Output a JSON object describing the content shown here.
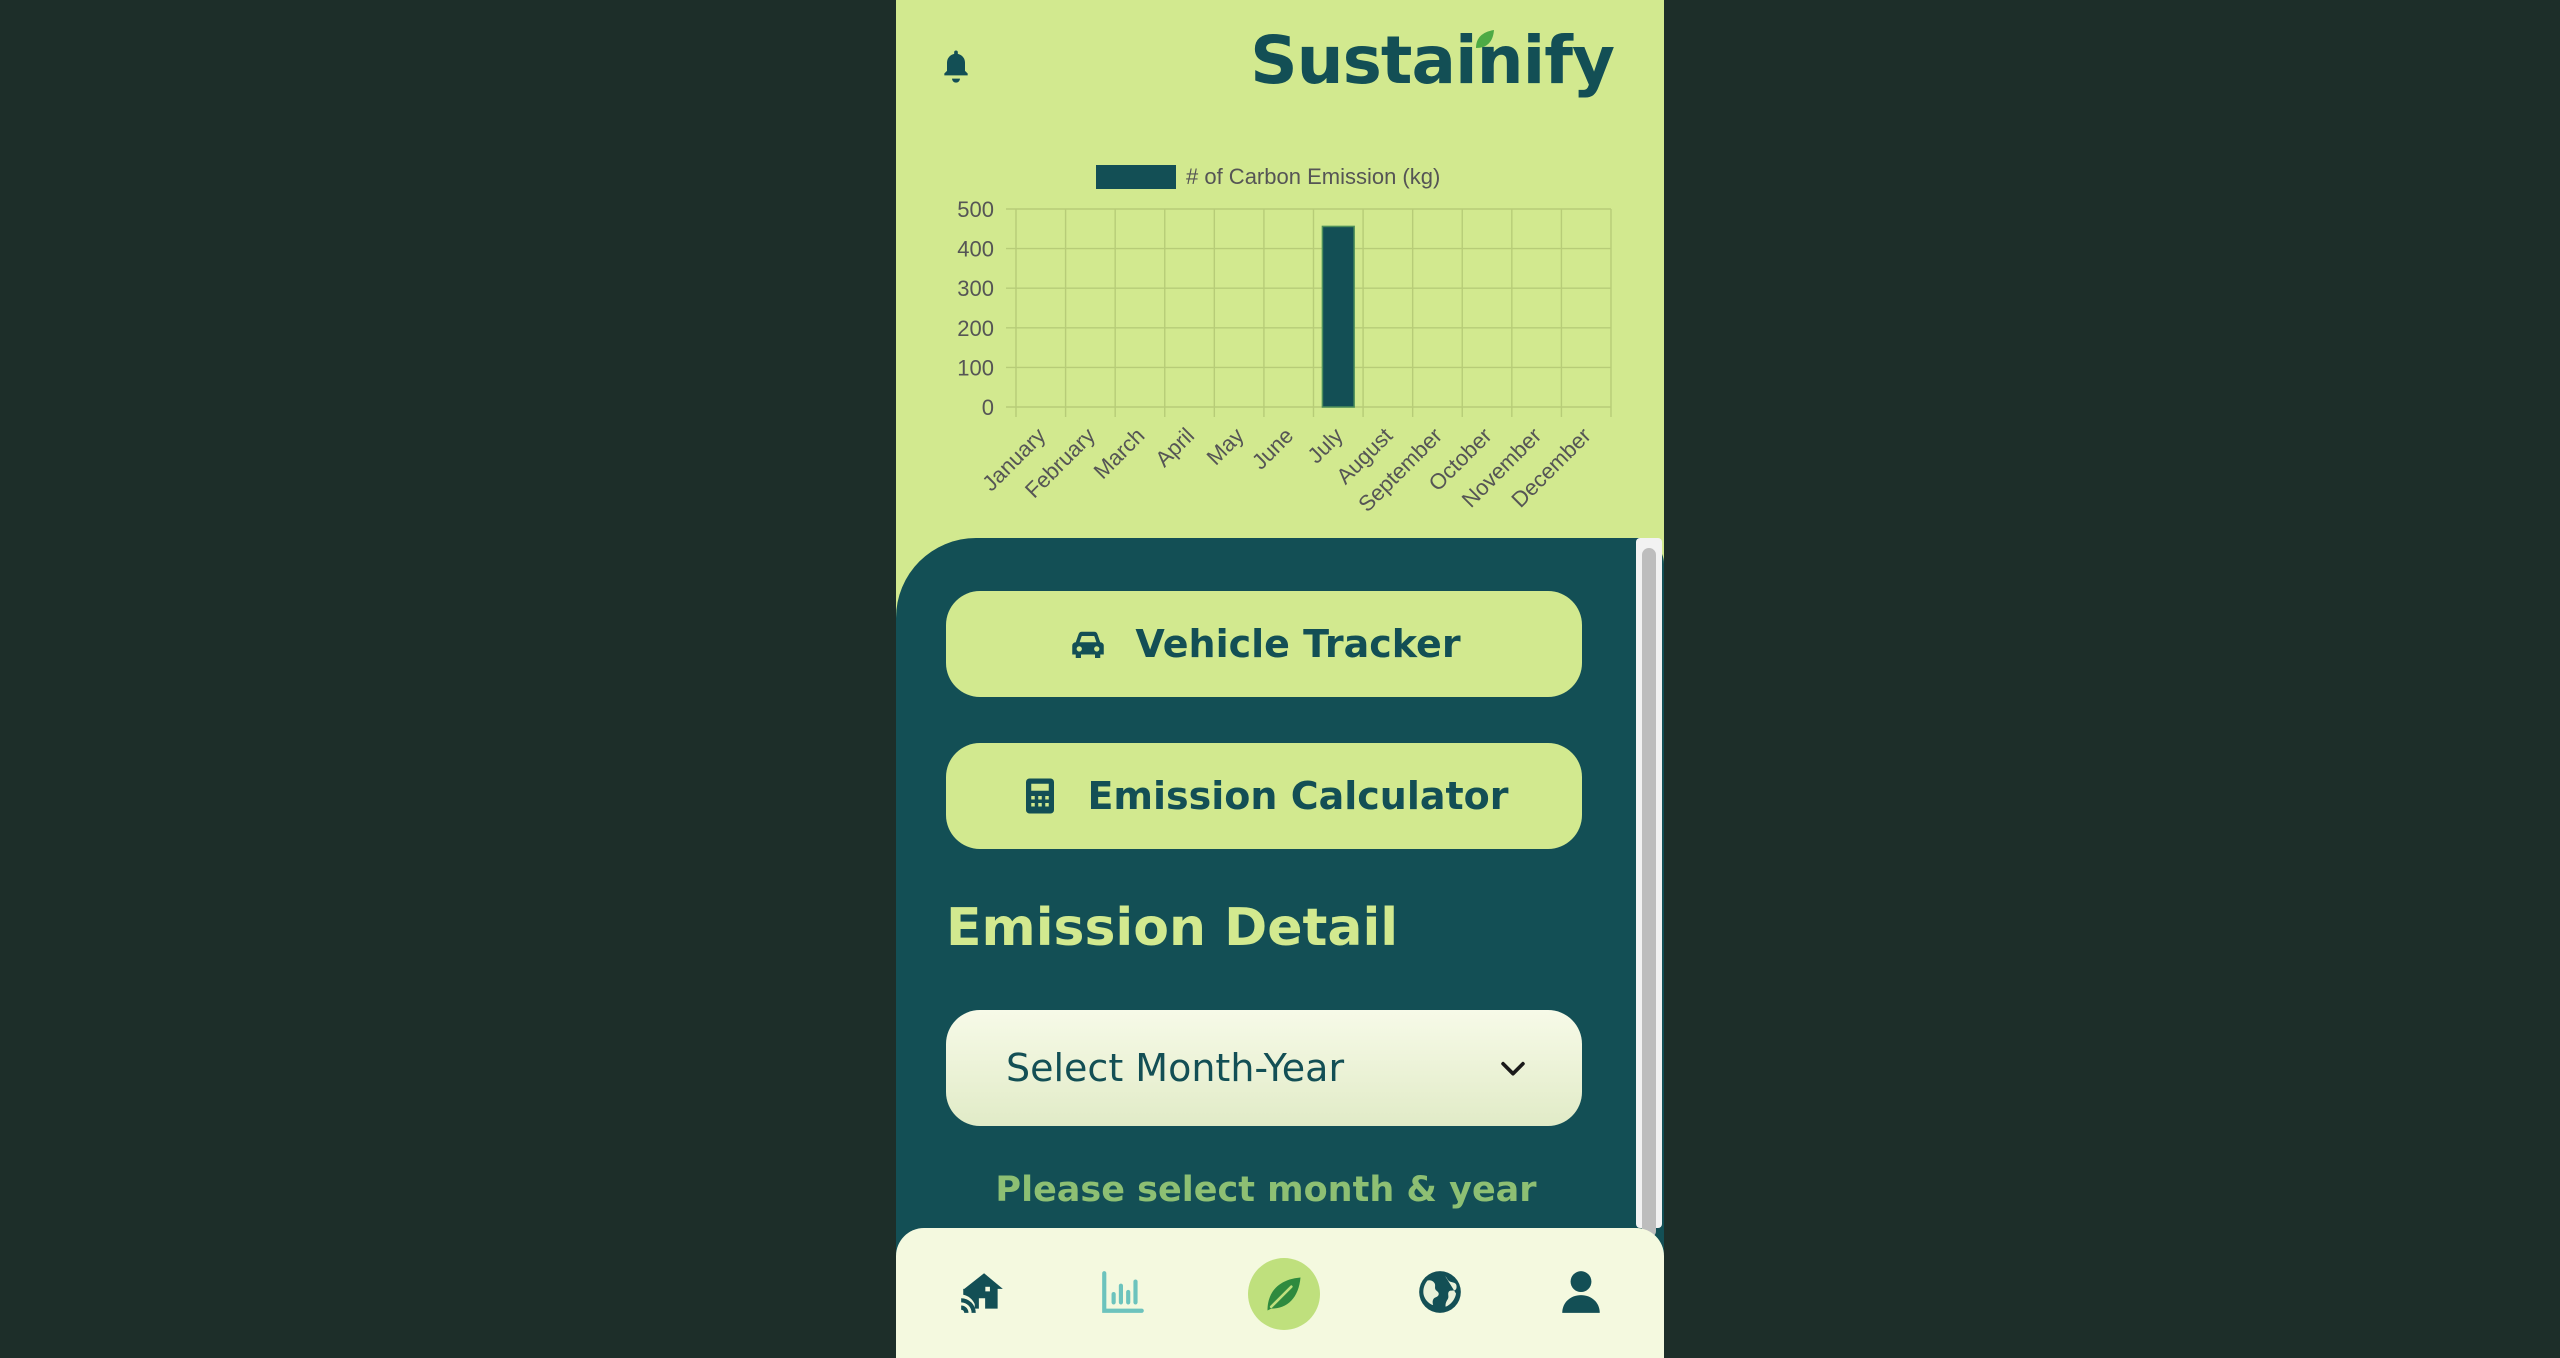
{
  "header": {
    "bell_icon": "bell-icon",
    "logo_text": "Sustainify"
  },
  "chart_data": {
    "type": "bar",
    "legend": "# of Carbon Emission (kg)",
    "categories": [
      "January",
      "February",
      "March",
      "April",
      "May",
      "June",
      "July",
      "August",
      "September",
      "October",
      "November",
      "December"
    ],
    "values": [
      0,
      0,
      0,
      0,
      0,
      0,
      456,
      0,
      0,
      0,
      0,
      0
    ],
    "ylim": [
      0,
      500
    ],
    "yticks": [
      0,
      100,
      200,
      300,
      400,
      500
    ],
    "grid": true,
    "legend_position": "top",
    "bar_color": "#134f55"
  },
  "actions": {
    "vehicle_tracker_label": "Vehicle Tracker",
    "emission_calculator_label": "Emission Calculator"
  },
  "detail": {
    "title": "Emission Detail",
    "select_value": "Select Month-Year",
    "hint": "Please select month & year"
  },
  "nav": {
    "items": [
      "home-wifi-icon",
      "bar-chart-icon",
      "leaf-icon",
      "globe-icon",
      "user-icon"
    ],
    "active": "leaf-icon"
  },
  "colors": {
    "primary": "#134f55",
    "accent": "#d2e98f",
    "background": "#1d2e29"
  }
}
